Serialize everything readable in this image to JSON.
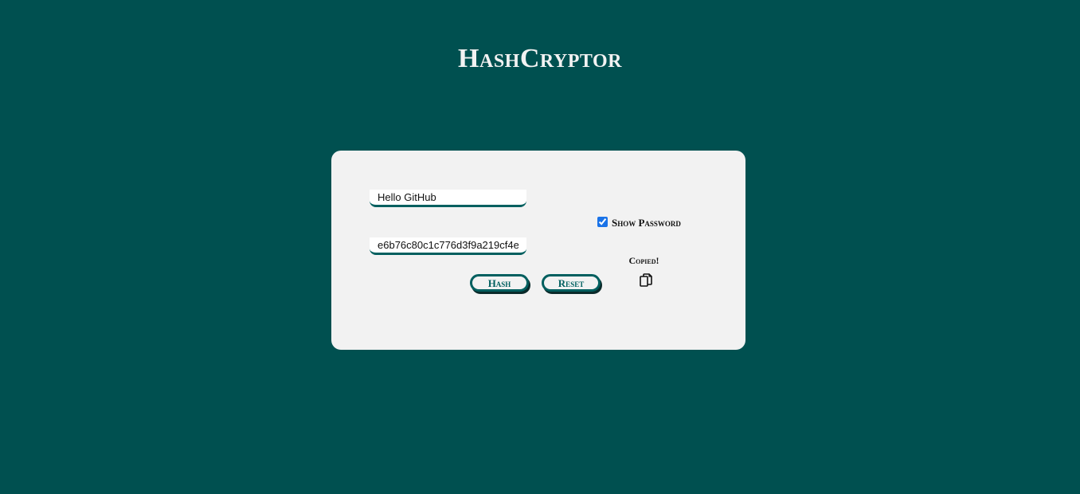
{
  "app": {
    "title": "HashCryptor"
  },
  "form": {
    "input_value": "Hello GitHub",
    "output_value": "e6b76c80c1c776d3f9a219cf4e",
    "show_password_label": "Show Password",
    "show_password_checked": true,
    "hash_button_label": "Hash",
    "reset_button_label": "Reset",
    "copied_label": "Copied!",
    "copy_icon": "copy-icon"
  },
  "colors": {
    "background": "#005050",
    "card": "#f2f2f2",
    "accent": "#005f5f",
    "title_text": "#f2f2f2"
  }
}
